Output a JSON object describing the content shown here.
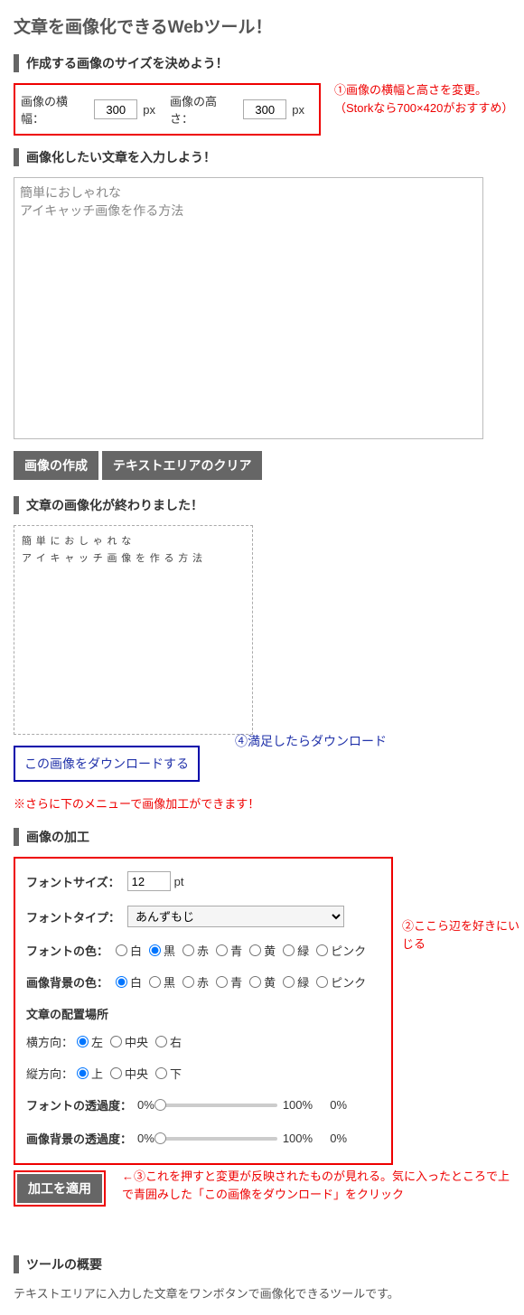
{
  "title": "文章を画像化できるWebツール！",
  "sections": {
    "size": "作成する画像のサイズを決めよう！",
    "input": "画像化したい文章を入力しよう！",
    "done": "文章の画像化が終わりました！",
    "proc": "画像の加工",
    "overview": "ツールの概要"
  },
  "size": {
    "width_label": "画像の横幅：",
    "width_value": "300",
    "height_label": "画像の高さ：",
    "height_value": "300",
    "unit": "px"
  },
  "annot": {
    "a1": "①画像の横幅と高さを変更。（Storkなら700×420がおすすめ）",
    "a2": "②ここら辺を好きにいじる",
    "a3_arrow": "←",
    "a3": "③これを押すと変更が反映されたものが見れる。気に入ったところで上で青囲みした「この画像をダウンロード」をクリック",
    "a4": "④満足したらダウンロード"
  },
  "textarea": {
    "value": "簡単におしゃれな\nアイキャッチ画像を作る方法"
  },
  "buttons": {
    "create": "画像の作成",
    "clear": "テキストエリアのクリア",
    "apply": "加工を適用"
  },
  "preview": {
    "line1": "簡 単 に お し ゃ れ な",
    "line2": "ア イ キ ャ ッ チ 画 像 を 作 る 方 法"
  },
  "download_link": "この画像をダウンロードする",
  "red_note": "※さらに下のメニューで画像加工ができます！",
  "proc": {
    "font_size_label": "フォントサイズ：",
    "font_size_value": "12",
    "pt": "pt",
    "font_type_label": "フォントタイプ：",
    "font_type_value": "あんずもじ",
    "font_color_label": "フォントの色：",
    "bg_color_label": "画像背景の色：",
    "colors": [
      "白",
      "黒",
      "赤",
      "青",
      "黄",
      "緑",
      "ピンク"
    ],
    "font_color_selected": "黒",
    "bg_color_selected": "白",
    "align_head": "文章の配置場所",
    "h_label": "横方向：",
    "h_options": [
      "左",
      "中央",
      "右"
    ],
    "h_selected": "左",
    "v_label": "縦方向：",
    "v_options": [
      "上",
      "中央",
      "下"
    ],
    "v_selected": "上",
    "font_opacity_label": "フォントの透過度：",
    "bg_opacity_label": "画像背景の透過度：",
    "pct0": "0%",
    "pct100": "100%",
    "cur": "0%"
  },
  "desc": "テキストエリアに入力した文章をワンボタンで画像化できるツールです。"
}
